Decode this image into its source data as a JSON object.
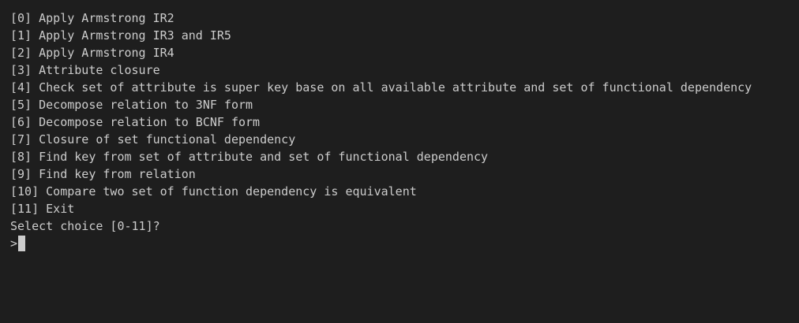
{
  "terminal": {
    "menu": [
      "[0] Apply Armstrong IR2",
      "[1] Apply Armstrong IR3 and IR5",
      "[2] Apply Armstrong IR4",
      "[3] Attribute closure",
      "[4] Check set of attribute is super key base on all available attribute and set of functional dependency",
      "[5] Decompose relation to 3NF form",
      "[6] Decompose relation to BCNF form",
      "[7] Closure of set functional dependency",
      "[8] Find key from set of attribute and set of functional dependency",
      "[9] Find key from relation",
      "[10] Compare two set of function dependency is equivalent",
      "[11] Exit"
    ],
    "question": "Select choice [0-11]?",
    "prompt": ">",
    "input_value": ""
  }
}
